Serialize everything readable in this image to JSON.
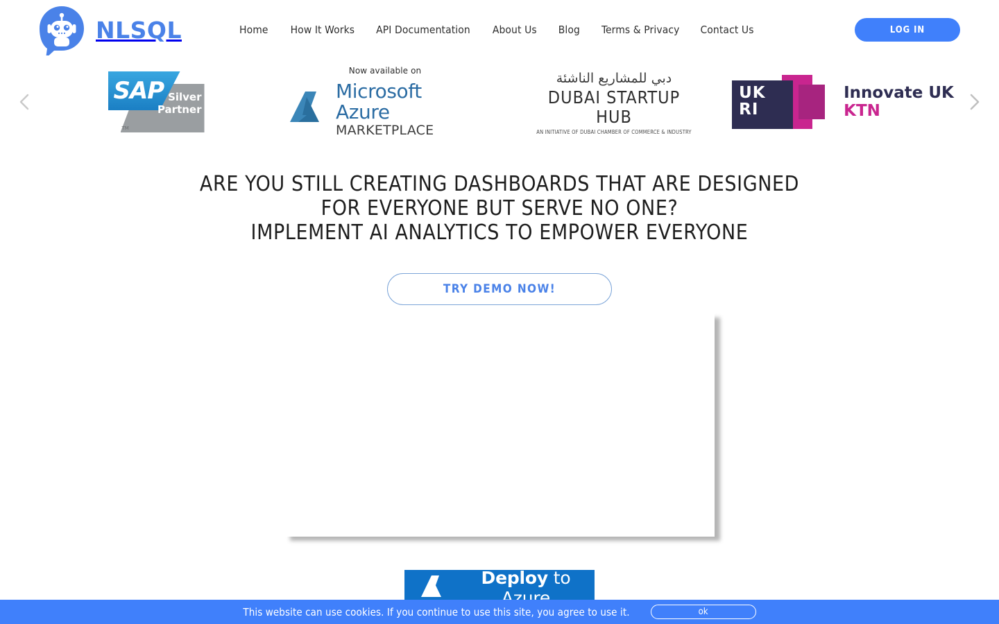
{
  "brand": {
    "name": "NLSQL",
    "logo_icon": "chat-robot-icon",
    "accent_color": "#4a82e8"
  },
  "nav": {
    "items": [
      {
        "label": "Home"
      },
      {
        "label": "How It Works"
      },
      {
        "label": "API Documentation"
      },
      {
        "label": "About Us"
      },
      {
        "label": "Blog"
      },
      {
        "label": "Terms & Privacy"
      },
      {
        "label": "Contact Us"
      }
    ],
    "login_label": "LOG IN",
    "login_color": "#4080fb"
  },
  "carousel": {
    "prev_icon": "chevron-left-icon",
    "next_icon": "chevron-right-icon",
    "slides": [
      {
        "id": "sap-silver-partner",
        "mark": "SAP",
        "line1": "Silver",
        "line2": "Partner",
        "trademark": "TM",
        "blue": "#2f9fdc",
        "gray": "#9a9ea1"
      },
      {
        "id": "microsoft-azure-marketplace",
        "eyebrow": "Now available on",
        "title": "Microsoft Azure",
        "subtitle": "MARKETPLACE",
        "color": "#2b6ca3"
      },
      {
        "id": "dubai-startup-hub",
        "arabic": "دبي للمشاريع الناشئة",
        "title": "DUBAI STARTUP HUB",
        "tagline": "AN INITIATIVE OF DUBAI CHAMBER OF COMMERCE & INDUSTRY"
      },
      {
        "id": "innovate-uk-ktn",
        "mark": "UKRI",
        "line1": "Innovate UK",
        "line2": "KTN",
        "navy": "#2e2d52",
        "magenta": "#c9258f"
      }
    ]
  },
  "hero": {
    "headline_lines": [
      "ARE YOU STILL CREATING DASHBOARDS THAT ARE DESIGNED",
      "FOR EVERYONE BUT SERVE NO ONE?",
      "IMPLEMENT AI ANALYTICS TO EMPOWER EVERYONE"
    ],
    "cta_label": "TRY DEMO NOW!"
  },
  "deploy": {
    "icon": "azure-logo-icon",
    "label_strong": "Deploy",
    "label_rest": " to Azure",
    "background": "#0f72c8"
  },
  "cookie": {
    "message": "This website can use cookies. If you continue to use this site, you agree to use it.",
    "ok_label": "ok",
    "background": "#4080fb"
  }
}
